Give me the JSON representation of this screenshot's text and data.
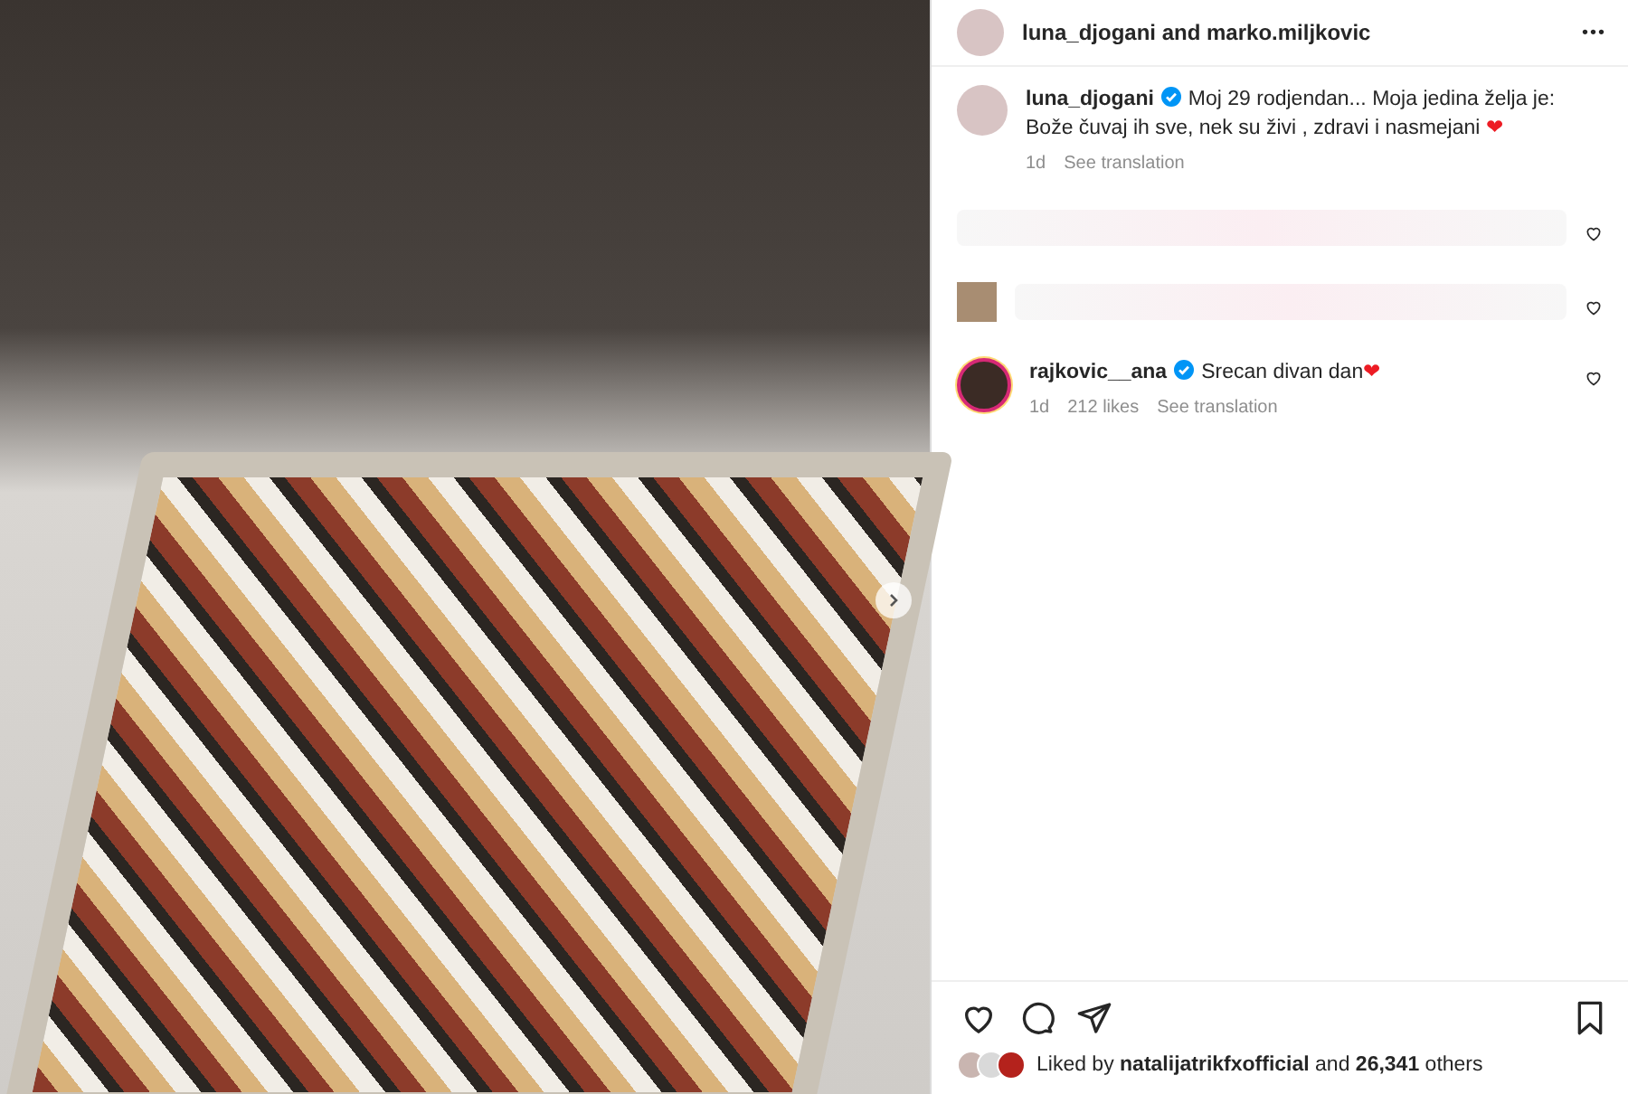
{
  "post": {
    "has_next": true
  },
  "header": {
    "authors": "luna_djogani and marko.miljkovic",
    "more": "•••"
  },
  "caption": {
    "username": "luna_djogani",
    "verified": true,
    "text": "Moj 29 rodjendan... Moja jedina želja je: Bože čuvaj ih sve, nek su živi , zdravi i nasmejani",
    "emoji": "❤",
    "time": "1d",
    "translate": "See translation"
  },
  "comments": [
    {
      "kind": "blurred",
      "liked": false
    },
    {
      "kind": "blurred",
      "liked": false
    },
    {
      "kind": "comment",
      "username": "rajkovic__ana",
      "verified": true,
      "text": "Srecan divan dan",
      "emoji": "❤",
      "time": "1d",
      "likes": "212 likes",
      "translate": "See translation",
      "story_ring": true,
      "liked": false
    }
  ],
  "actions": {
    "liked": false,
    "saved": false
  },
  "likes": {
    "text": "Liked by **natalijatrikfxofficial** and **26,341** others"
  }
}
